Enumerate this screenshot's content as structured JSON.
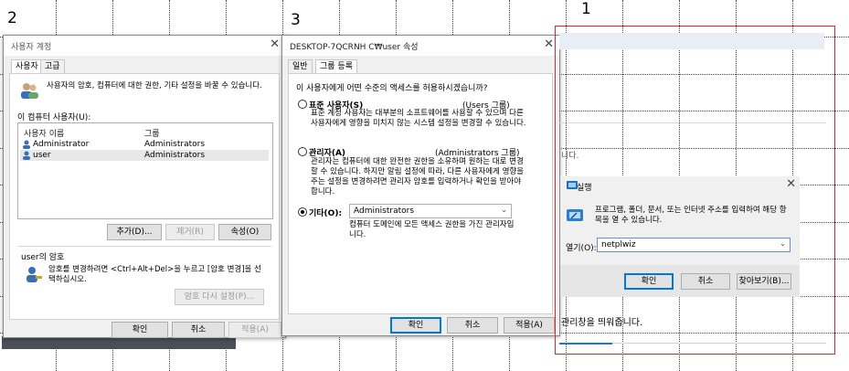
{
  "step_labels": {
    "one": "1",
    "two": "2",
    "three": "3"
  },
  "user_accounts": {
    "title": "사용자 계정",
    "tabs": [
      "사용자",
      "고급"
    ],
    "description": "사용자의 암호, 컴퓨터에 대한 권한, 기타 설정을 바꿀 수 있습니다.",
    "users_label": "이 컴퓨터 사용자(U):",
    "columns": {
      "name": "사용자 이름",
      "group": "그룹"
    },
    "rows": [
      {
        "name": "Administrator",
        "group": "Administrators"
      },
      {
        "name": "user",
        "group": "Administrators"
      }
    ],
    "buttons": {
      "add": "추가(D)...",
      "remove": "제거(R)",
      "properties": "속성(O)"
    },
    "password_section": "user의 암호",
    "password_text": "암호를 변경하려면 <Ctrl+Alt+Del>을 누르고 [암호 변경]을 선택하십시오.",
    "reset_password": "암호 다시 설정(P)...",
    "ok": "확인",
    "cancel": "취소",
    "apply": "적용(A)"
  },
  "user_properties": {
    "title": "DESKTOP-7QCRNH C₩user 속성",
    "tabs": [
      "일반",
      "그룹 등록"
    ],
    "question": "이 사용자에게 어떤 수준의 액세스를 허용하시겠습니까?",
    "standard": {
      "label": "표준 사용자(S)",
      "group": "(Users 그룹)",
      "desc": "표준 계정 사용자는 대부분의 소프트웨어를 사용할 수 있으며 다른 사용자에게 영향을 미치지 않는 시스템 설정을 변경할 수 있습니다."
    },
    "admin": {
      "label": "관리자(A)",
      "group": "(Administrators 그룹)",
      "desc": "관리자는 컴퓨터에 대한 완전한 권한을 소유하며 원하는 대로 변경할 수 있습니다. 하지만 알림 설정에 따라, 다른 사용자에게 영향을 주는 설정을 변경하려면 관리자 암호를 입력하거나 확인을 받아야 합니다."
    },
    "other": {
      "label": "기타(O):",
      "selected": "Administrators",
      "desc": "컴퓨터 도메인에 모든 액세스 권한을 가진 관리자입니다."
    },
    "ok": "확인",
    "cancel": "취소",
    "apply": "적용(A)"
  },
  "run_dialog": {
    "partial_text_top": "니다.",
    "title": "실행",
    "description": "프로그램, 폴더, 문서, 또는 인터넷 주소를 입력하여 해당 항목을 열 수 있습니다.",
    "open_label": "열기(O):",
    "open_value": "netplwiz",
    "ok": "확인",
    "cancel": "취소",
    "browse": "찾아보기(B)...",
    "footer_text": "관리창을 띄워줍니다."
  }
}
